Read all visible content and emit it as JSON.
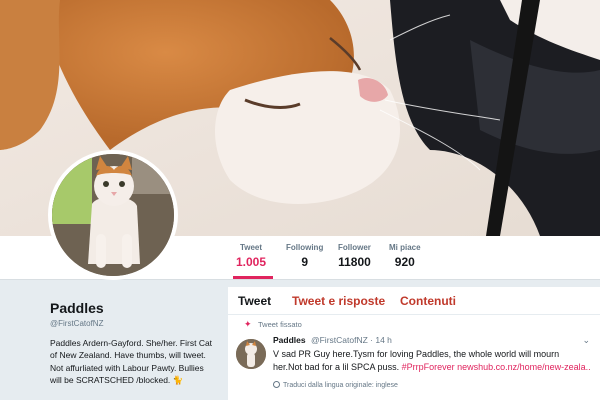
{
  "profile": {
    "name": "Paddles",
    "handle": "@FirstCatofNZ",
    "bio_lines": [
      "Paddles Ardern-Gayford. She/her. First Cat",
      "of New Zealand. Have thumbs, will tweet.",
      "Not affurliated with Labour Pawty. Bullies",
      "will be SCRATSCHED /blocked. 🐈"
    ]
  },
  "stats": [
    {
      "label": "Tweet",
      "value": "1.005"
    },
    {
      "label": "Following",
      "value": "9"
    },
    {
      "label": "Follower",
      "value": "11800"
    },
    {
      "label": "Mi piace",
      "value": "920"
    }
  ],
  "tabs": [
    {
      "label": "Tweet"
    },
    {
      "label": "Tweet e risposte"
    },
    {
      "label": "Contenuti"
    }
  ],
  "pinned_tweet": {
    "pinned_label": "Tweet fissato",
    "name": "Paddles",
    "meta": "@FirstCatofNZ · 14 h",
    "text_line1": "V sad PR Guy here.Tysm for loving Paddles, the whole world will mourn",
    "text_line2_plain": "her.Not bad for a lil SPCA puss. ",
    "text_line2_link": "#PrrpForever newshub.co.nz/home/new-zeala...",
    "translate_label": "Traduci dalla lingua originale: inglese"
  },
  "icons": {
    "pin": "pin-icon",
    "caret": "chevron-down-icon",
    "globe": "globe-icon"
  },
  "colors": {
    "accent": "#e0245e",
    "tab_inactive": "#c0392b"
  }
}
